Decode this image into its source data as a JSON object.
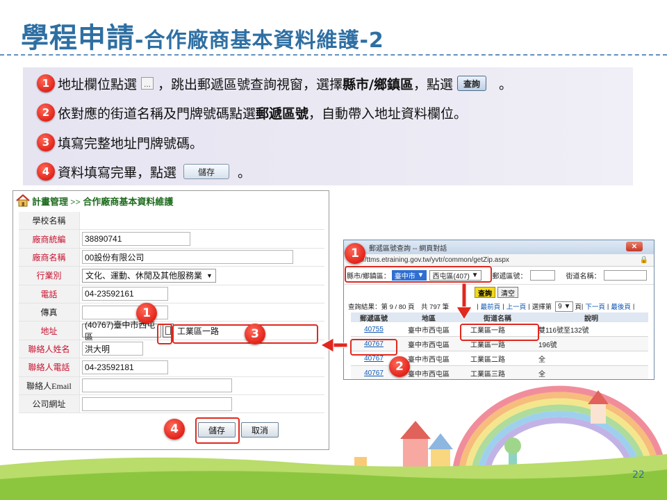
{
  "title": {
    "main": "學程申請",
    "sub": "-合作廠商基本資料維護-2"
  },
  "instructions": [
    {
      "num": "1",
      "text_a": "地址欄位點選",
      "dots": "…",
      "text_b": "，跳出郵遞區號查詢視窗，選擇",
      "bold": "縣市/鄉鎮區",
      "text_c": "，點選",
      "button": "查詢",
      "text_d": "。"
    },
    {
      "num": "2",
      "text_a": "依對應的街道名稱及門牌號碼點選",
      "bold": "郵遞區號",
      "text_b": "，自動帶入地址資料欄位。"
    },
    {
      "num": "3",
      "text_a": "填寫完整地址門牌號碼。"
    },
    {
      "num": "4",
      "text_a": "資料填寫完畢，點選",
      "button": "儲存",
      "text_b": "。"
    }
  ],
  "form": {
    "breadcrumb": "計畫管理 >> 合作廠商基本資料維護",
    "rows": [
      {
        "label": "學校名稱",
        "value": ""
      },
      {
        "label": "廠商統編",
        "value": "38890741"
      },
      {
        "label": "廠商名稱",
        "value": "00設份有限公司"
      },
      {
        "label": "行業別",
        "value": "文化、運動、休閒及其他服務業"
      },
      {
        "label": "電話",
        "value": "04-23592161"
      },
      {
        "label": "傳真",
        "value": ""
      },
      {
        "label": "地址",
        "value": "(40767)臺中市西屯區",
        "value2": "工業區一路"
      },
      {
        "label": "聯絡人姓名",
        "value": "洪大明"
      },
      {
        "label": "聯絡人電話",
        "value": "04-23592181"
      },
      {
        "label": "聯絡人Email",
        "value": ""
      },
      {
        "label": "公司網址",
        "value": ""
      }
    ],
    "save_label": "儲存",
    "cancel_label": "取消"
  },
  "popup": {
    "title": "郵遞區號查詢 -- 網頁對話",
    "url": "ttps://ttms.etraining.gov.tw/yvtr/common/getZip.aspx",
    "county_label": "縣市/鄉鎮區：",
    "county_value": "臺中市",
    "district_value": "西屯區(407)",
    "zip_label": "郵遞區號：",
    "street_label": "街道名稱：",
    "query_label": "查詢",
    "clear_label": "清空",
    "pager": {
      "result": "查詢結果：第 9 / 80 頁　共 797 筆",
      "first": "最前頁",
      "prev": "上一頁",
      "choose": "選擇第",
      "page": "9",
      "page_unit": "頁",
      "next": "下一頁",
      "last": "最後頁"
    },
    "headers": [
      "郵遞區號",
      "地區",
      "街道名稱",
      "說明"
    ],
    "rows": [
      [
        "40755",
        "臺中市西屯區",
        "工業區一路",
        "雙116號至132號"
      ],
      [
        "40767",
        "臺中市西屯區",
        "工業區一路",
        "196號"
      ],
      [
        "40767",
        "臺中市西屯區",
        "工業區二路",
        "全"
      ],
      [
        "40767",
        "臺中市西屯區",
        "工業區三路",
        "全"
      ]
    ]
  },
  "badges": {
    "b1": "1",
    "b2": "2",
    "b3": "3",
    "b4": "4"
  },
  "page_number": "22",
  "colors": {
    "title": "#2e6fa3",
    "badge": "#e2231a",
    "required_label": "#c8102e",
    "link": "#0b56b5"
  }
}
